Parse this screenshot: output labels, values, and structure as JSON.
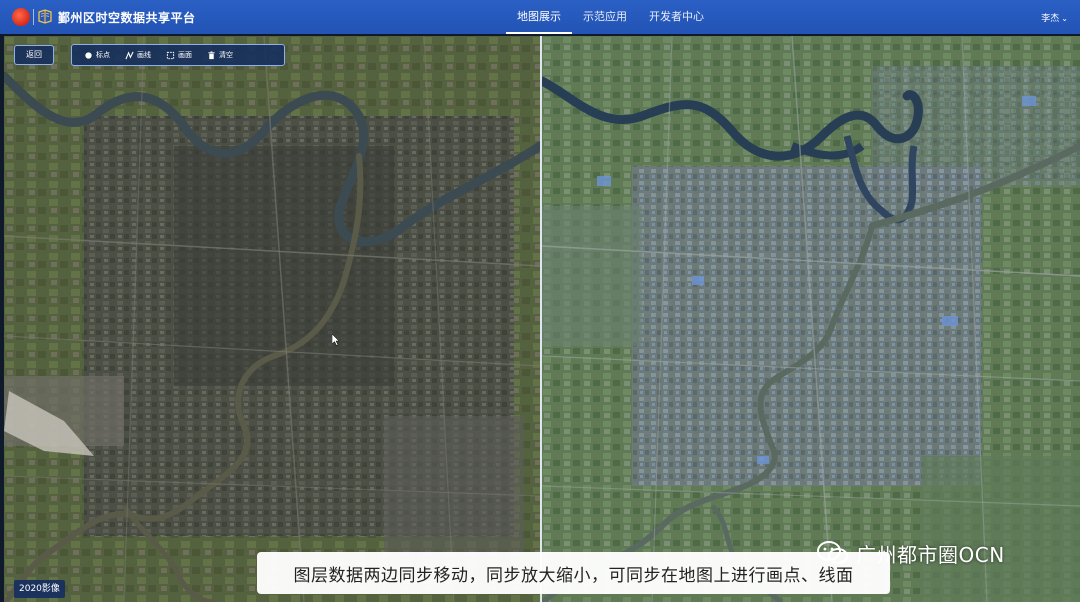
{
  "header": {
    "app_title": "鄞州区时空数据共享平台",
    "nav": [
      {
        "label": "地图展示",
        "active": true
      },
      {
        "label": "示范应用",
        "active": false
      },
      {
        "label": "开发者中心",
        "active": false
      }
    ],
    "user": "李杰"
  },
  "toolbar": {
    "back_label": "返回",
    "tools": [
      {
        "label": "标点",
        "icon": "point-icon"
      },
      {
        "label": "画线",
        "icon": "line-icon"
      },
      {
        "label": "画面",
        "icon": "polygon-icon"
      },
      {
        "label": "清空",
        "icon": "trash-icon"
      }
    ]
  },
  "left_map": {
    "year_label": "2020影像"
  },
  "caption": "图层数据两边同步移动，同步放大缩小，可同步在地图上进行画点、线面",
  "watermark": "广州都市圈OCN",
  "colors": {
    "header": "#2354b5",
    "toolbar_bg": "#142d5f",
    "toolbar_border": "#8fb0e8"
  }
}
